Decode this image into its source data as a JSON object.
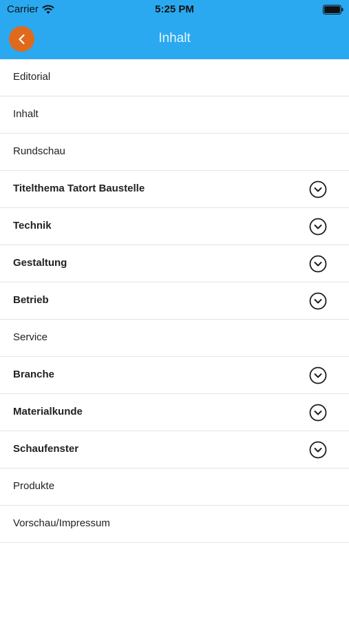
{
  "status_bar": {
    "carrier": "Carrier",
    "time": "5:25 PM"
  },
  "nav": {
    "title": "Inhalt",
    "back_icon": "chevron-left-icon",
    "back_color": "#e06a1c",
    "header_color": "#2aa9f0"
  },
  "items": [
    {
      "label": "Editorial",
      "expandable": false
    },
    {
      "label": "Inhalt",
      "expandable": false
    },
    {
      "label": "Rundschau",
      "expandable": false
    },
    {
      "label": "Titelthema Tatort Baustelle",
      "expandable": true
    },
    {
      "label": "Technik",
      "expandable": true
    },
    {
      "label": "Gestaltung",
      "expandable": true
    },
    {
      "label": "Betrieb",
      "expandable": true
    },
    {
      "label": "Service",
      "expandable": false
    },
    {
      "label": "Branche",
      "expandable": true
    },
    {
      "label": "Materialkunde",
      "expandable": true
    },
    {
      "label": "Schaufenster",
      "expandable": true
    },
    {
      "label": "Produkte",
      "expandable": false
    },
    {
      "label": "Vorschau/Impressum",
      "expandable": false
    }
  ]
}
